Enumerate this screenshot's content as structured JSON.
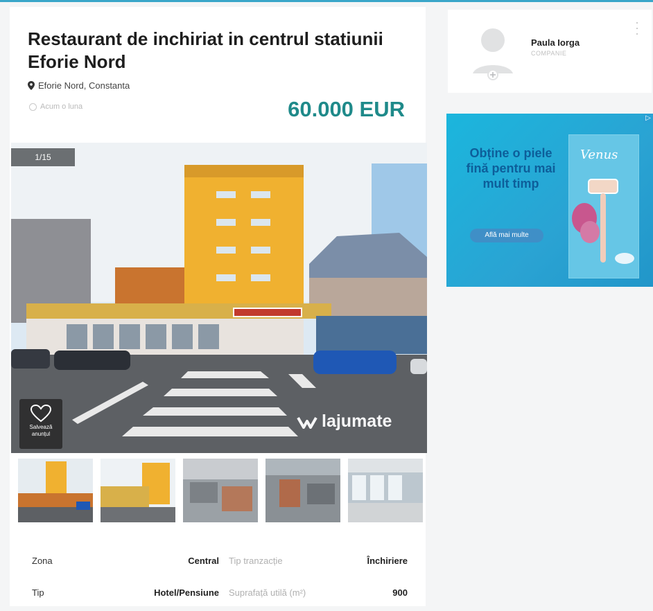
{
  "listing": {
    "title": "Restaurant de inchiriat in centrul statiunii Eforie Nord",
    "location": "Eforie Nord, Constanta",
    "time_posted": "Acum o luna",
    "price": "60.000 EUR",
    "photo_counter": "1/15",
    "favorite_label": "Salvează anunțul",
    "watermark": "lajumate",
    "details": [
      {
        "label": "Zona",
        "value": "Central",
        "label2": "Tip tranzacție",
        "value2": "Închiriere"
      },
      {
        "label": "Tip",
        "value": "Hotel/Pensiune",
        "label2": "Suprafață utilă (m²)",
        "value2": "900"
      }
    ]
  },
  "seller": {
    "name": "Paula Iorga",
    "subtitle": "COMPANIE"
  },
  "ad": {
    "headline": "Obține o piele fină pentru mai mult timp",
    "cta": "Află mai multe",
    "brand": "Venus",
    "badge": "▷"
  },
  "icons": {
    "location": "map-pin-icon",
    "time": "clock-icon",
    "favorite": "heart-icon",
    "more": "kebab-menu-icon",
    "avatar": "user-avatar-icon"
  },
  "colors": {
    "price": "#1f8a8a",
    "accent": "#3aa6c9",
    "ad_background": "#1bb6dd"
  }
}
